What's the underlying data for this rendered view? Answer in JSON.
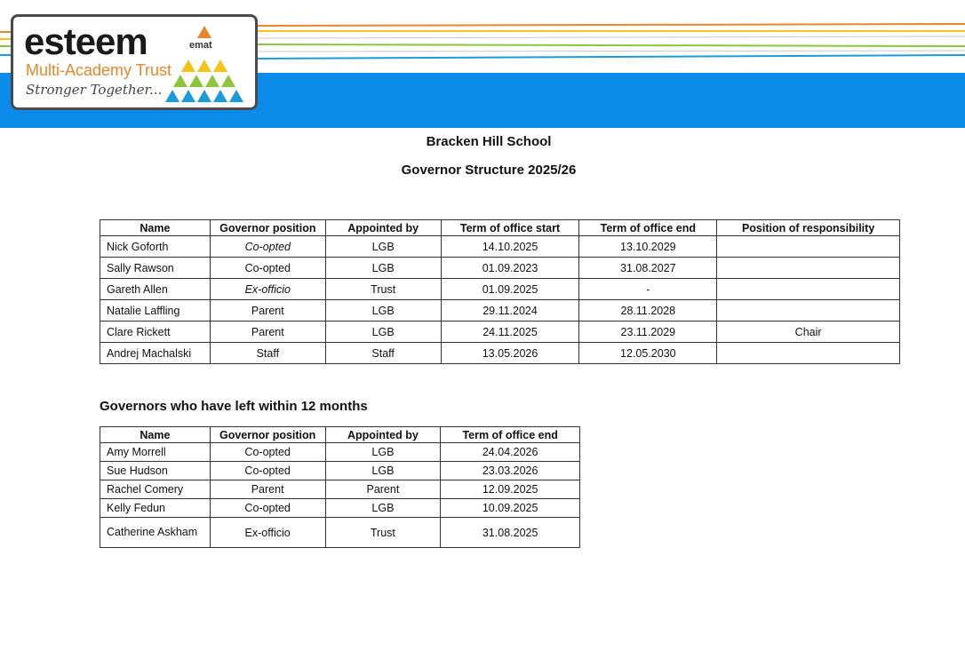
{
  "logo": {
    "brand": "esteem",
    "sub_brand": "emat",
    "trust_name": "Multi-Academy Trust",
    "tagline": "Stronger Together..."
  },
  "colors": {
    "header_band": "#0a8bea",
    "logo_orange": "#e8862a",
    "logo_yellow": "#f3c21b",
    "logo_green": "#8cc63f",
    "logo_blue": "#1b9bd7"
  },
  "document": {
    "school": "Bracken Hill School",
    "title": "Governor Structure 2025/26"
  },
  "current_table": {
    "headers": [
      "Name",
      "Governor position",
      "Appointed by",
      "Term of office start",
      "Term of office end",
      "Position of responsibility"
    ],
    "rows": [
      [
        "Nick Goforth",
        "Co-opted",
        "LGB",
        "14.10.2025",
        "13.10.2029",
        ""
      ],
      [
        "Sally Rawson",
        "Co-opted",
        "LGB",
        "01.09.2023",
        "31.08.2027",
        ""
      ],
      [
        "Gareth Allen",
        "Ex-officio",
        "Trust",
        "01.09.2025",
        "-",
        ""
      ],
      [
        "Natalie Laffling",
        "Parent",
        "LGB",
        "29.11.2024",
        "28.11.2028",
        ""
      ],
      [
        "Clare Rickett",
        "Parent",
        "LGB",
        "24.11.2025",
        "23.11.2029",
        "Chair"
      ],
      [
        "Andrej Machalski",
        "Staff",
        "Staff",
        "13.05.2026",
        "12.05.2030",
        ""
      ]
    ]
  },
  "left_section": {
    "heading": "Governors who have left within 12 months",
    "headers": [
      "Name",
      "Governor position",
      "Appointed by",
      "Term of office end"
    ],
    "rows": [
      [
        "Amy Morrell",
        "Co-opted",
        "LGB",
        "24.04.2026"
      ],
      [
        "Sue Hudson",
        "Co-opted",
        "LGB",
        "23.03.2026"
      ],
      [
        "Rachel Comery",
        "Parent",
        "Parent",
        "12.09.2025"
      ],
      [
        "Kelly Fedun",
        "Co-opted",
        "LGB",
        "10.09.2025"
      ],
      [
        "Catherine Askham",
        "Ex-officio",
        "Trust",
        "31.08.2025"
      ]
    ]
  }
}
